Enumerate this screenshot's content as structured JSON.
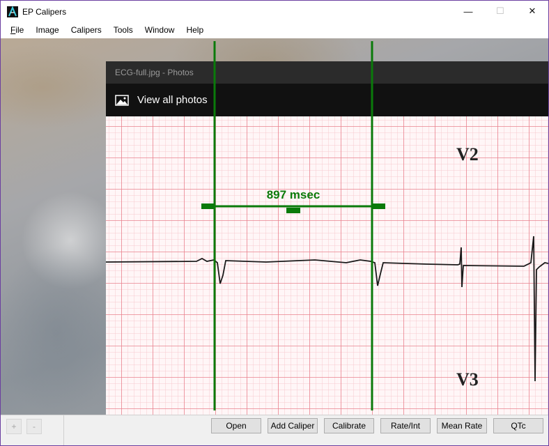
{
  "window": {
    "title": "EP Calipers",
    "controls": {
      "minimize": "—",
      "maximize": "☐",
      "close": "✕"
    }
  },
  "menu": {
    "items": [
      {
        "mnemonic": "F",
        "rest": "ile"
      },
      {
        "mnemonic": "",
        "rest": "Image"
      },
      {
        "mnemonic": "",
        "rest": "Calipers"
      },
      {
        "mnemonic": "",
        "rest": "Tools"
      },
      {
        "mnemonic": "",
        "rest": "Window"
      },
      {
        "mnemonic": "",
        "rest": "Help"
      }
    ]
  },
  "photos": {
    "window_title": "ECG-full.jpg - Photos",
    "view_all": "View all photos",
    "lead_labels": {
      "upper": "V2",
      "lower": "V3"
    }
  },
  "caliper": {
    "measurement": "897 msec",
    "color": "#0a7a0a"
  },
  "toolbar": {
    "zoom_in": "+",
    "zoom_out": "-",
    "open": "Open",
    "add_caliper": "Add Caliper",
    "calibrate": "Calibrate",
    "rate_int": "Rate/Int",
    "mean_rate": "Mean Rate",
    "qtc": "QTc"
  },
  "colors": {
    "ecg_grid_major": "#e9828e",
    "ecg_grid_minor": "#f7c9cf",
    "ecg_trace": "#1a1a1a",
    "photos_titlebar": "#2b2b2b",
    "photos_toolbar": "#111111"
  }
}
